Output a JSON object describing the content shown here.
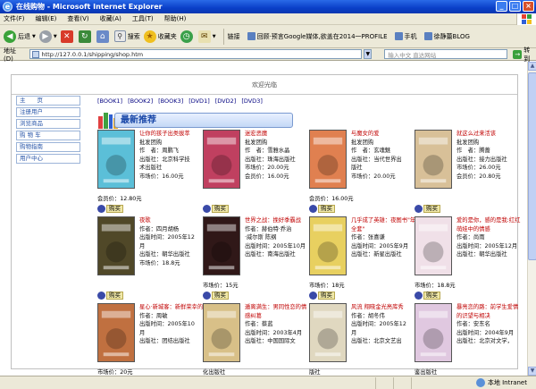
{
  "window": {
    "title": "在线购物 - Microsoft Internet Explorer",
    "controls": [
      "_",
      "□",
      "×"
    ]
  },
  "menu": [
    "文件(F)",
    "编辑(E)",
    "查看(V)",
    "收藏(A)",
    "工具(T)",
    "帮助(H)"
  ],
  "toolbar": {
    "back": "后退",
    "search": "搜索",
    "favorites": "收藏夹"
  },
  "links": {
    "label": "链接",
    "items": [
      "回顾·预言Google媒体,欲盖在2014一PROFILE",
      "手机",
      "徐静蕾BLOG"
    ]
  },
  "address": {
    "label": "地址(D)",
    "value": "http://127.0.0.1/shipping/shop.htm",
    "search_placeholder": "输入中文 直达网站",
    "go": "转到"
  },
  "page": {
    "welcome": "欢迎光临",
    "nav": [
      "主　　页",
      "注册用户",
      "浏览商品",
      "购 物 车",
      "购物指南",
      "用户中心"
    ],
    "categories": [
      "[BOOK1]",
      "[BOOK2]",
      "[BOOK3]",
      "[DVD1]",
      "[DVD2]",
      "[DVD3]"
    ],
    "banner": "最新推荐",
    "buy_label": "购买",
    "products": [
      {
        "title": "让你的孩子出类拔萃",
        "lines": [
          "批发团购",
          "作　者：周鹏飞",
          "出版社：北京科学技",
          "术出版社",
          "市场价：16.00元"
        ],
        "price": "会员价：12.80元",
        "cover": "#5bbfd8"
      },
      {
        "title": "迷宏恶魔",
        "lines": [
          "批发团购",
          "作　者：雪雅水晶",
          "出版社：珠海出版社",
          "市场价：20.00元",
          "会员价：16.00元"
        ],
        "price": "",
        "cover": "#c04060"
      },
      {
        "title": "与魔女的爱",
        "lines": [
          "批发团购",
          "作　者：玄魂魅",
          "出版社：当代世界出",
          "版社",
          "市场价：20.00元"
        ],
        "price": "会员价：16.00元",
        "cover": "#e08050"
      },
      {
        "title": "就这么过来活该",
        "lines": [
          "批发团购",
          "作　者：腾蔷",
          "出版社：接力出版社",
          "市场价：26.00元",
          "会员价：20.80元"
        ],
        "price": "",
        "cover": "#d8c098"
      },
      {
        "title": "夜歌",
        "lines": [
          "作者：四月胡杨",
          "出版时间：2005年12",
          "月",
          "出版社：朝华出版社",
          "市场价：18.8元"
        ],
        "price": "",
        "cover": "#504828"
      },
      {
        "title": "世界之战：挽好季霸战",
        "lines": [
          "作者：赫伯特·乔治",
          "·威尔斯 陈纲",
          "出版时间：2005年10月",
          "出版社：南海出版社"
        ],
        "price": "市场价：15元",
        "cover": "#301818"
      },
      {
        "title": "几乎成了英雄：夜图书\"年全套\"",
        "lines": [
          "作者：张喜谦",
          "出版时间：2005年9月",
          "出版社：新星出版社"
        ],
        "price": "市场价：18元",
        "cover": "#e8d060"
      },
      {
        "title": "爱的是你，感的是我:红红萌娃中的情感",
        "lines": [
          "作者：尚雨",
          "出版时间：2005年12月",
          "出版社：朝华出版社"
        ],
        "price": "市场价：18.8元",
        "cover": "#f0e0e8"
      },
      {
        "title": "星心·新城客：新鲜荣幸的",
        "lines": [
          "作者：周敏",
          "出版时间：2005年10",
          "月",
          "出版社：团结出版社"
        ],
        "price": "市场价：20元",
        "cover": "#c07040"
      },
      {
        "title": "遁离满生：男同性恋的情感纠葛",
        "lines": [
          "作者：蔡蓝",
          "出版时间：2003年4月",
          "出版社：中国国际文"
        ],
        "price": "化出版社",
        "cover": "#d8c088"
      },
      {
        "title": "风流 翔晓金光亮库秀",
        "lines": [
          "作者：胡冬伟",
          "出版时间：2005年12",
          "月",
          "出版社：北京文艺出"
        ],
        "price": "版社",
        "cover": "#e0d8c0"
      },
      {
        "title": "暴亮恋的路：前学生爱情的识望与相决",
        "lines": [
          "作者：安东名",
          "出版时间：2004年9月",
          "出版社：北京对文学，"
        ],
        "price": "鉴出版社",
        "cover": "#e0c8e0"
      }
    ]
  },
  "status": {
    "zone": "本地 Intranet"
  }
}
